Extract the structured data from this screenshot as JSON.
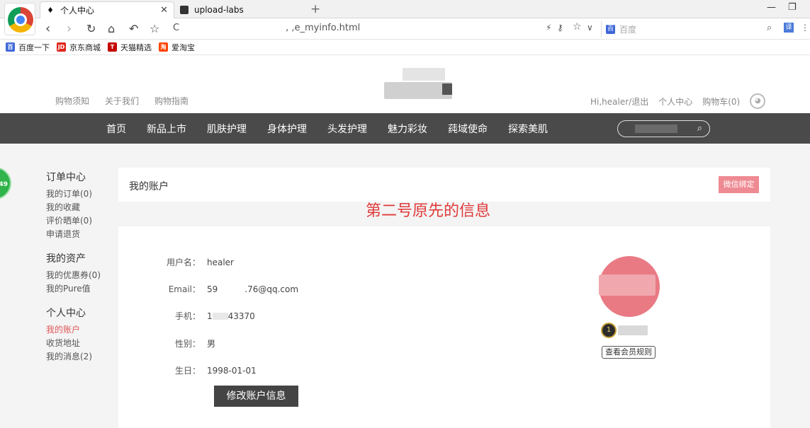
{
  "browser": {
    "active_tab_title": "个人中心",
    "inactive_tab_title": "upload-labs",
    "url_prefix": "C",
    "url_suffix": ", ,e_myinfo.html",
    "search_engine_placeholder": "百度",
    "bookmarks": [
      "百度一下",
      "京东商城",
      "天猫精选",
      "爱淘宝"
    ]
  },
  "site": {
    "header_links_left": [
      "购物须知",
      "关于我们",
      "购物指南"
    ],
    "user_greeting": "Hi,healer/退出",
    "personal_center": "个人中心",
    "cart": "购物车(0)",
    "nav_items": [
      "首页",
      "新品上市",
      "肌肤护理",
      "身体护理",
      "头发护理",
      "魅力彩妆",
      "莼域使命",
      "探索美肌"
    ]
  },
  "sidebar": {
    "groups": [
      {
        "title": "订单中心",
        "items": [
          "我的订单(0)",
          "我的收藏",
          "评价晒单(0)",
          "申请退货"
        ]
      },
      {
        "title": "我的资产",
        "items": [
          "我的优惠券(0)",
          "我的Pure值"
        ]
      },
      {
        "title": "个人中心",
        "items": [
          "我的账户",
          "收货地址",
          "我的消息(2)"
        ]
      }
    ]
  },
  "float_badge": "49",
  "account": {
    "title": "我的账户",
    "wechat_bind": "微信绑定",
    "annotation": "第二号原先的信息",
    "fields": [
      {
        "label": "用户名：",
        "value": "healer"
      },
      {
        "label": "Email：",
        "value_start": "59",
        "value_end": ".76@qq.com"
      },
      {
        "label": "手机：",
        "value_start": "1 ",
        "value_end": "43370"
      },
      {
        "label": "性别：",
        "value": "男"
      },
      {
        "label": "生日：",
        "value": "1998-01-01"
      }
    ],
    "edit_button": "修改账户信息",
    "member_badge": "1",
    "rules_button": "查看会员规则"
  },
  "colors": {
    "nav_bg": "#4a4a4a",
    "accent_pink": "#ee8a92",
    "annotation_red": "#e03a3a",
    "active_side_item": "#e0585a"
  }
}
